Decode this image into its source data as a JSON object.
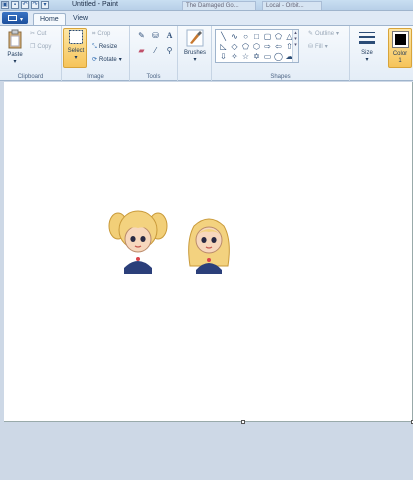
{
  "window": {
    "title": "Untitled - Paint",
    "ghost_tabs": [
      "The Damaged Go...",
      "Local - Orbit..."
    ]
  },
  "tabs": [
    {
      "label": "Home",
      "active": true
    },
    {
      "label": "View",
      "active": false
    }
  ],
  "ribbon": {
    "clipboard": {
      "paste": "Paste",
      "cut": "Cut",
      "copy": "Copy",
      "label": "Clipboard"
    },
    "image": {
      "select": "Select",
      "crop": "Crop",
      "resize": "Resize",
      "rotate": "Rotate",
      "label": "Image"
    },
    "tools": {
      "label": "Tools"
    },
    "brushes": {
      "label": "Brushes"
    },
    "shapes": {
      "outline": "Outline",
      "fill": "Fill",
      "label": "Shapes"
    },
    "size": {
      "label": "Size"
    },
    "color1": {
      "label": "Color\n1"
    }
  },
  "colors": {
    "accent": "#f6c45a",
    "ribbon_bg": "#e4edf7",
    "workspace": "#cdd8e6"
  }
}
